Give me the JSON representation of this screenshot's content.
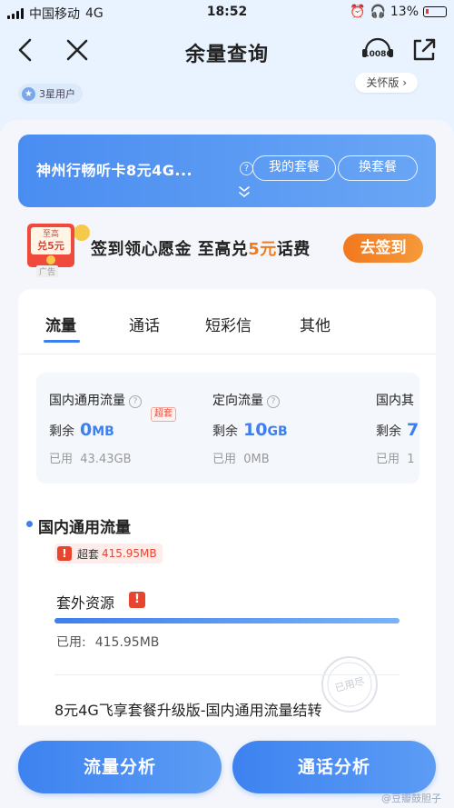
{
  "status_bar": {
    "carrier": "中国移动",
    "network": "4G",
    "time": "18:52",
    "battery": "13%"
  },
  "nav": {
    "title": "余量查询",
    "service_number": "10086"
  },
  "user": {
    "level_label": "3星用户",
    "package_pill": "关怀版"
  },
  "plan": {
    "name": "神州行畅听卡8元4G...",
    "my_package_label": "我的套餐",
    "change_package_label": "换套餐"
  },
  "promo": {
    "envelope_line1": "至高",
    "envelope_line2": "兑5元",
    "ad_label": "广告",
    "text_part1": "签到领心愿金 至高兑",
    "text_highlight": "5元",
    "text_part2": "话费",
    "button_label": "去签到"
  },
  "tabs": [
    {
      "label": "流量",
      "active": true
    },
    {
      "label": "通话",
      "active": false
    },
    {
      "label": "短彩信",
      "active": false
    },
    {
      "label": "其他",
      "active": false
    }
  ],
  "flow_summary": [
    {
      "label": "国内通用流量",
      "remaining_prefix": "剩余",
      "remaining_value": "0",
      "remaining_unit": "MB",
      "used_prefix": "已用",
      "used_value": "43.43GB",
      "over_tag": "超套"
    },
    {
      "label": "定向流量",
      "remaining_prefix": "剩余",
      "remaining_value": "10",
      "remaining_unit": "GB",
      "used_prefix": "已用",
      "used_value": "0MB"
    },
    {
      "label": "国内其",
      "remaining_prefix": "剩余",
      "remaining_value": "7",
      "remaining_unit": "",
      "used_prefix": "已用",
      "used_value": "1"
    }
  ],
  "detail": {
    "section_title": "国内通用流量",
    "over_label": "超套",
    "over_value": "415.95MB",
    "extra_title": "套外资源",
    "extra_progress": 1.0,
    "used_label": "已用:",
    "used_value": "415.95MB",
    "stamp_text": "已用尽",
    "plan_name": "8元4G飞享套餐升级版-国内通用流量结转"
  },
  "bottom_buttons": {
    "flow_analysis": "流量分析",
    "call_analysis": "通话分析"
  },
  "watermark": "@豆瓣鼓胆子",
  "colors": {
    "accent": "#3d7ff0",
    "orange": "#f07b1c",
    "danger": "#e8452f"
  }
}
